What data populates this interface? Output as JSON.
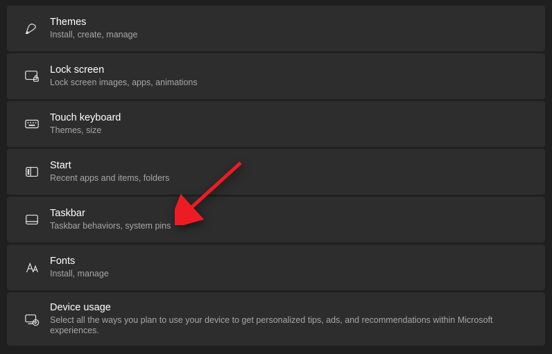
{
  "items": [
    {
      "key": "themes",
      "title": "Themes",
      "desc": "Install, create, manage"
    },
    {
      "key": "lock",
      "title": "Lock screen",
      "desc": "Lock screen images, apps, animations"
    },
    {
      "key": "touchkb",
      "title": "Touch keyboard",
      "desc": "Themes, size"
    },
    {
      "key": "start",
      "title": "Start",
      "desc": "Recent apps and items, folders"
    },
    {
      "key": "taskbar",
      "title": "Taskbar",
      "desc": "Taskbar behaviors, system pins"
    },
    {
      "key": "fonts",
      "title": "Fonts",
      "desc": "Install, manage"
    },
    {
      "key": "device",
      "title": "Device usage",
      "desc": "Select all the ways you plan to use your device to get personalized tips, ads, and recommendations within Microsoft experiences."
    }
  ],
  "annotation": {
    "arrow_target": "taskbar"
  }
}
